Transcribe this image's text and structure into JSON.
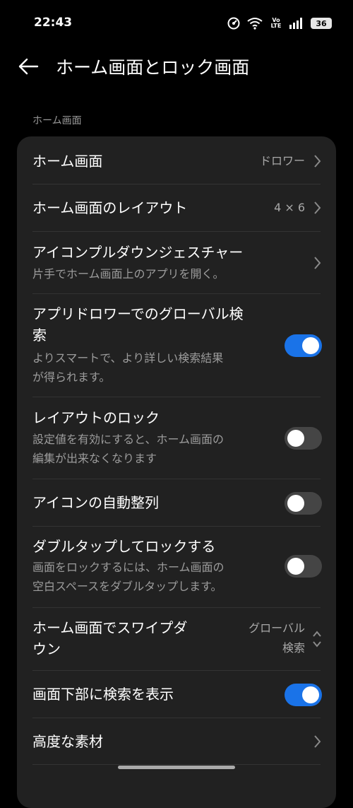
{
  "status": {
    "time": "22:43",
    "battery": "36",
    "volte": "Vo LTE"
  },
  "header": {
    "title": "ホーム画面とロック画面"
  },
  "section": {
    "label": "ホーム画面"
  },
  "rows": [
    {
      "title": "ホーム画面",
      "value": "ドロワー"
    },
    {
      "title": "ホーム画面のレイアウト",
      "value": "4 × 6"
    },
    {
      "title": "アイコンプルダウンジェスチャー",
      "subtitle": "片手でホーム画面上のアプリを開く。"
    },
    {
      "title_line1": "アプリドロワーでのグローバル検",
      "title_line2": "索",
      "subtitle_line1": "よりスマートで、より詳しい検索結果",
      "subtitle_line2": "が得られます。",
      "toggle": true
    },
    {
      "title": "レイアウトのロック",
      "subtitle_line1": "設定値を有効にすると、ホーム画面の",
      "subtitle_line2": "編集が出来なくなります",
      "toggle": false
    },
    {
      "title": "アイコンの自動整列",
      "toggle": false
    },
    {
      "title": "ダブルタップしてロックする",
      "subtitle_line1": "画面をロックするには、ホーム画面の",
      "subtitle_line2": "空白スペースをダブルタップします。",
      "toggle": false
    },
    {
      "title_line1": "ホーム画面でスワイプダ",
      "title_line2": "ウン",
      "value_line1": "グローバル",
      "value_line2": "検索"
    },
    {
      "title": "画面下部に検索を表示",
      "toggle": true
    },
    {
      "title": "高度な素材"
    }
  ]
}
